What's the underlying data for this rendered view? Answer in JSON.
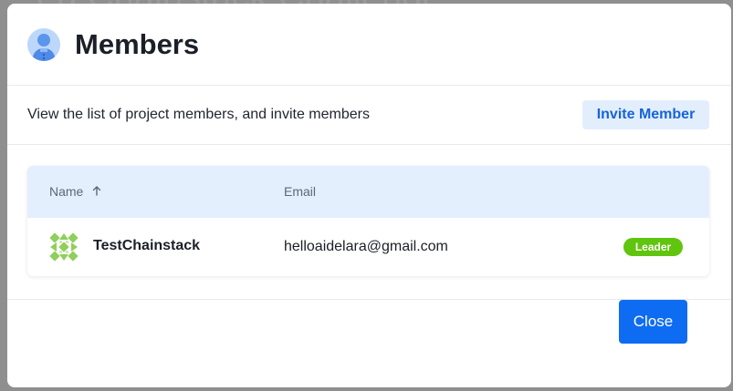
{
  "backdrop": {
    "title": "ed Chainstack Challenge"
  },
  "modal": {
    "title": "Members",
    "header_icon": "user-avatar-icon",
    "description": "View the list of project members, and invite members",
    "invite_label": "Invite Member",
    "close_label": "Close"
  },
  "table": {
    "columns": {
      "name": "Name",
      "email": "Email"
    },
    "sort_icon": "arrow-up-icon",
    "rows": [
      {
        "name": "TestChainstack",
        "email": "helloaidelara@gmail.com",
        "role": "Leader",
        "avatar_icon": "identicon-avatar"
      }
    ]
  },
  "colors": {
    "primary": "#0e6cf3",
    "invite_bg": "#e3eefd",
    "invite_text": "#1564d9",
    "table_header_bg": "#e4effd",
    "badge_green": "#61c40e",
    "avatar_green": "#8fcf5a"
  }
}
